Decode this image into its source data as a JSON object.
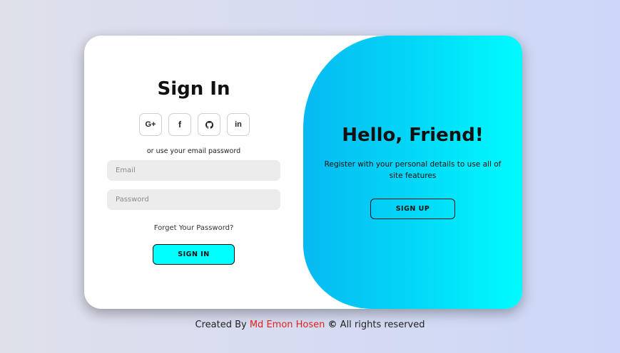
{
  "signin": {
    "title": "Sign In",
    "socials": [
      {
        "icon": "google-plus-icon",
        "glyph": "G+"
      },
      {
        "icon": "facebook-icon",
        "glyph": "f"
      },
      {
        "icon": "github-icon",
        "glyph": ""
      },
      {
        "icon": "linkedin-icon",
        "glyph": "in"
      }
    ],
    "hint": "or use your email password",
    "email_placeholder": "Email",
    "password_placeholder": "Password",
    "forgot": "Forget Your Password?",
    "button": "SIGN IN"
  },
  "panel": {
    "title": "Hello, Friend!",
    "text": "Register with your personal details to use all of site features",
    "button": "SIGN UP"
  },
  "footer": {
    "prefix": "Created By",
    "author": "Md Emon Hosen",
    "symbol": "©",
    "suffix": "All rights reserved"
  },
  "colors": {
    "accent": "#00ffff",
    "gradient_start": "#06b9f2",
    "gradient_end": "#00fbff",
    "author": "#e0201b"
  }
}
